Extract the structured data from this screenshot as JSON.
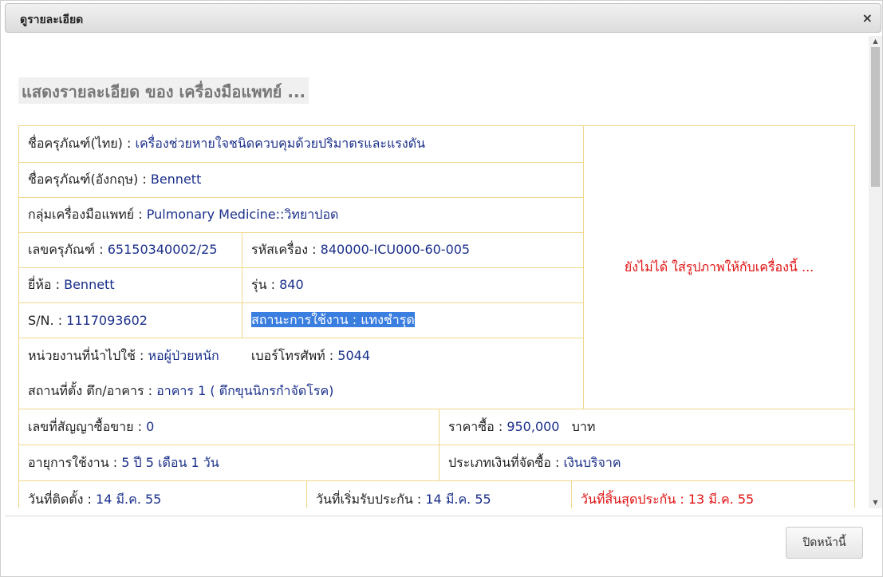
{
  "dialog": {
    "title": "ดูรายละเอียด",
    "close_icon": "×",
    "close_button": "ปิดหน้านี้"
  },
  "heading": "แสดงรายละเอียด ของ เครื่องมือแพทย์ ...",
  "equipment": {
    "name_th_label": "ชื่อครุภัณฑ์(ไทย) :",
    "name_th": "เครื่องช่วยหายใจชนิดควบคุมด้วยปริมาตรและแรงดัน",
    "name_en_label": "ชื่อครุภัณฑ์(อังกฤษ) :",
    "name_en": "Bennett",
    "group_label": "กลุ่มเครื่องมือแพทย์ :",
    "group": "Pulmonary Medicine::วิทยาปอด",
    "asset_no_label": "เลขครุภัณฑ์ :",
    "asset_no": "65150340002/25",
    "code_label": "รหัสเครื่อง :",
    "code": "840000-ICU000-60-005",
    "brand_label": "ยี่ห้อ :",
    "brand": "Bennett",
    "model_label": "รุ่น :",
    "model": "840",
    "sn_label": "S/N. :",
    "sn": "1117093602",
    "status_label": "สถานะการใช้งาน :",
    "status": "แทงชำรุด",
    "dept_label": "หน่วยงานที่นำไปใช้ :",
    "dept": "หอผู้ป่วยหนัก",
    "phone_label": "เบอร์โทรศัพท์ :",
    "phone": "5044",
    "location_label": "สถานที่ตั้ง ตึก/อาคาร :",
    "location": "อาคาร 1 ( ตึกขุนนิกรกำจัดโรค)",
    "no_image_text": "ยังไม่ได้ ใส่รูปภาพให้กับเครื่องนี้ ..."
  },
  "purchase": {
    "contract_label": "เลขที่สัญญาซื้อขาย :",
    "contract": "0",
    "price_label": "ราคาซื้อ :",
    "price": "950,000",
    "price_unit": "บาท",
    "age_label": "อายุการใช้งาน :",
    "age": "5 ปี 5 เดือน 1 วัน",
    "fund_label": "ประเภทเงินที่จัดซื้อ :",
    "fund": "เงินบริจาค",
    "install_label": "วันที่ติดตั้ง :",
    "install": "14 มี.ค. 55",
    "warranty_start_label": "วันที่เริ่มรับประกัน :",
    "warranty_start": "14 มี.ค. 55",
    "warranty_end_label": "วันที่สิ้นสุดประกัน :",
    "warranty_end": "13 มี.ค. 55"
  }
}
